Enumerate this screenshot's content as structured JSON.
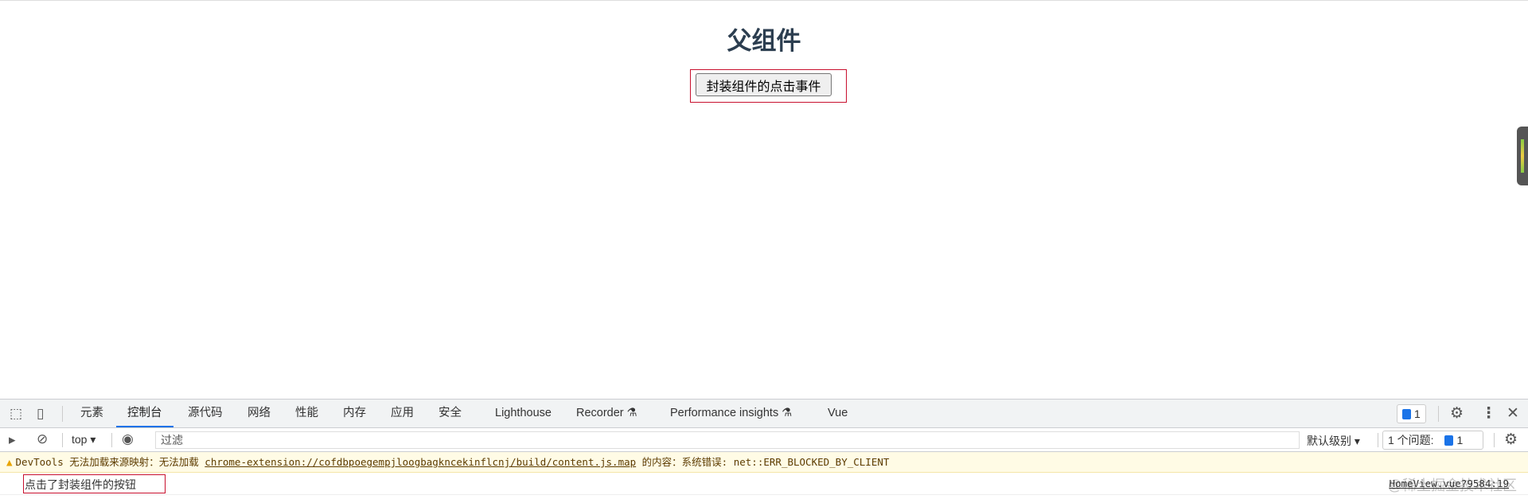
{
  "page": {
    "title": "父组件",
    "button_label": "封装组件的点击事件"
  },
  "devtools": {
    "tabs": [
      "元素",
      "控制台",
      "源代码",
      "网络",
      "性能",
      "内存",
      "应用",
      "安全",
      "Lighthouse",
      "Recorder",
      "Performance insights",
      "Vue"
    ],
    "active_tab": "控制台",
    "issues_badge": "1",
    "context": "top",
    "filter_placeholder": "过滤",
    "level": "默认级别",
    "issues_label": "1 个问题:",
    "issues_count": "1",
    "warning": {
      "prefix": "DevTools 无法加载来源映射：无法加载 ",
      "link": "chrome-extension://cofdbpoegempjloogbagkncekinflcnj/build/content.js.map",
      "suffix": " 的内容：系统错误: net::ERR_BLOCKED_BY_CLIENT"
    },
    "log": {
      "message": "点击了封装组件的按钮",
      "source": "HomeView.vue?9584:19"
    }
  },
  "watermark": "@稀土掘金技术社区",
  "colors": {
    "accent": "#1a73e8",
    "highlight_box": "#c8102e",
    "title": "#2c3e50"
  }
}
